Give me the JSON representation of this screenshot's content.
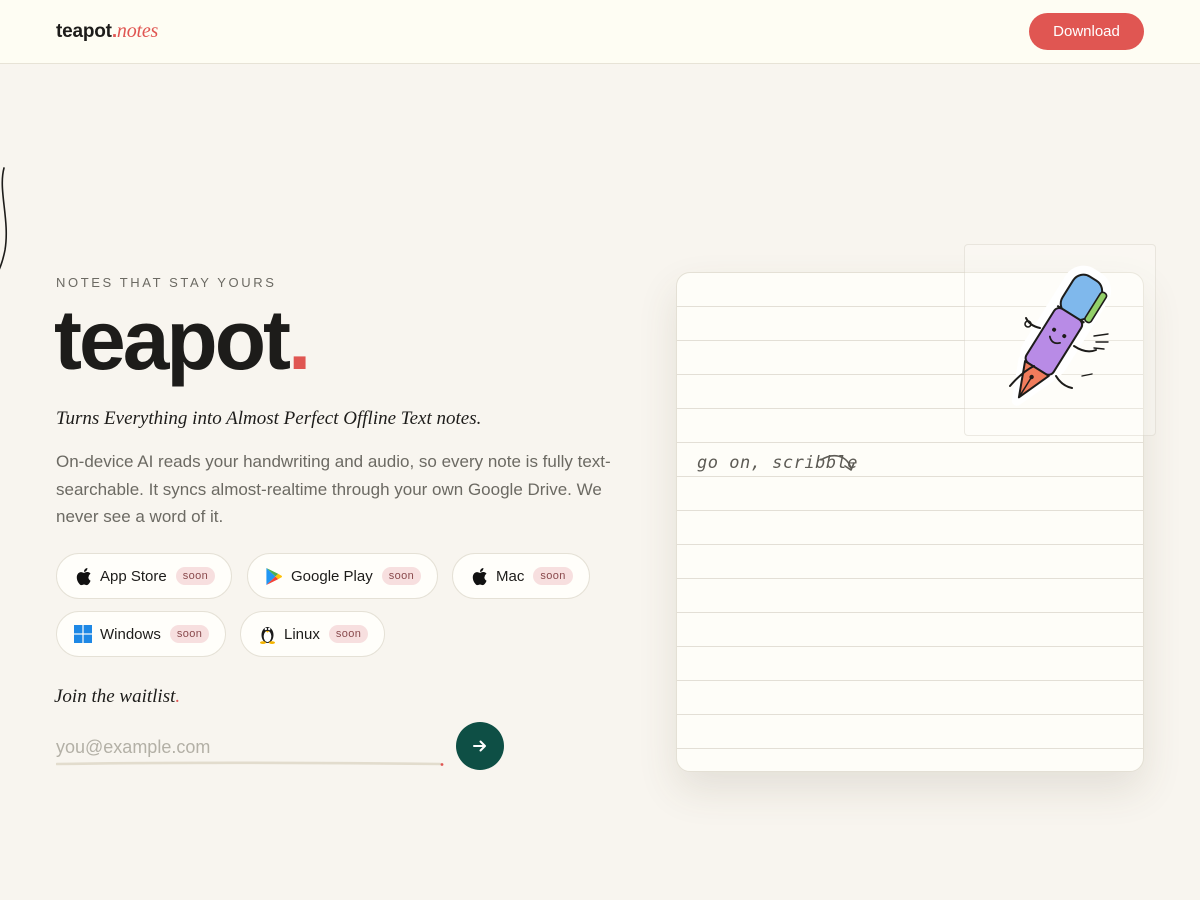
{
  "header": {
    "logo_word": "teapot",
    "logo_dot": ".",
    "logo_suffix": "notes",
    "download_label": "Download"
  },
  "hero": {
    "eyebrow": "NOTES THAT STAY YOURS",
    "title": "teapot",
    "title_dot": ".",
    "tagline": "Turns Everything into Almost Perfect Offline Text notes.",
    "description": "On-device AI reads your handwriting and audio, so every note is fully text-searchable. It syncs almost-realtime through your own Google Drive. We never see a word of it."
  },
  "platforms": [
    {
      "label": "App Store",
      "badge": "soon",
      "icon": "apple-icon"
    },
    {
      "label": "Google Play",
      "badge": "soon",
      "icon": "google-play-icon"
    },
    {
      "label": "Mac",
      "badge": "soon",
      "icon": "apple-icon"
    },
    {
      "label": "Windows",
      "badge": "soon",
      "icon": "windows-icon"
    },
    {
      "label": "Linux",
      "badge": "soon",
      "icon": "linux-tux-icon"
    }
  ],
  "waitlist": {
    "title": "Join the waitlist",
    "title_dot": ".",
    "email_placeholder": "you@example.com",
    "submit_icon": "arrow-right-icon"
  },
  "notebook": {
    "scribble_text": "go on, scribble",
    "sticker_icon": "fountain-pen-mascot-icon"
  },
  "colors": {
    "accent": "#e05652",
    "primary_dark": "#0e4f45",
    "background": "#f8f5ef",
    "header_bg": "#fefdf3"
  }
}
